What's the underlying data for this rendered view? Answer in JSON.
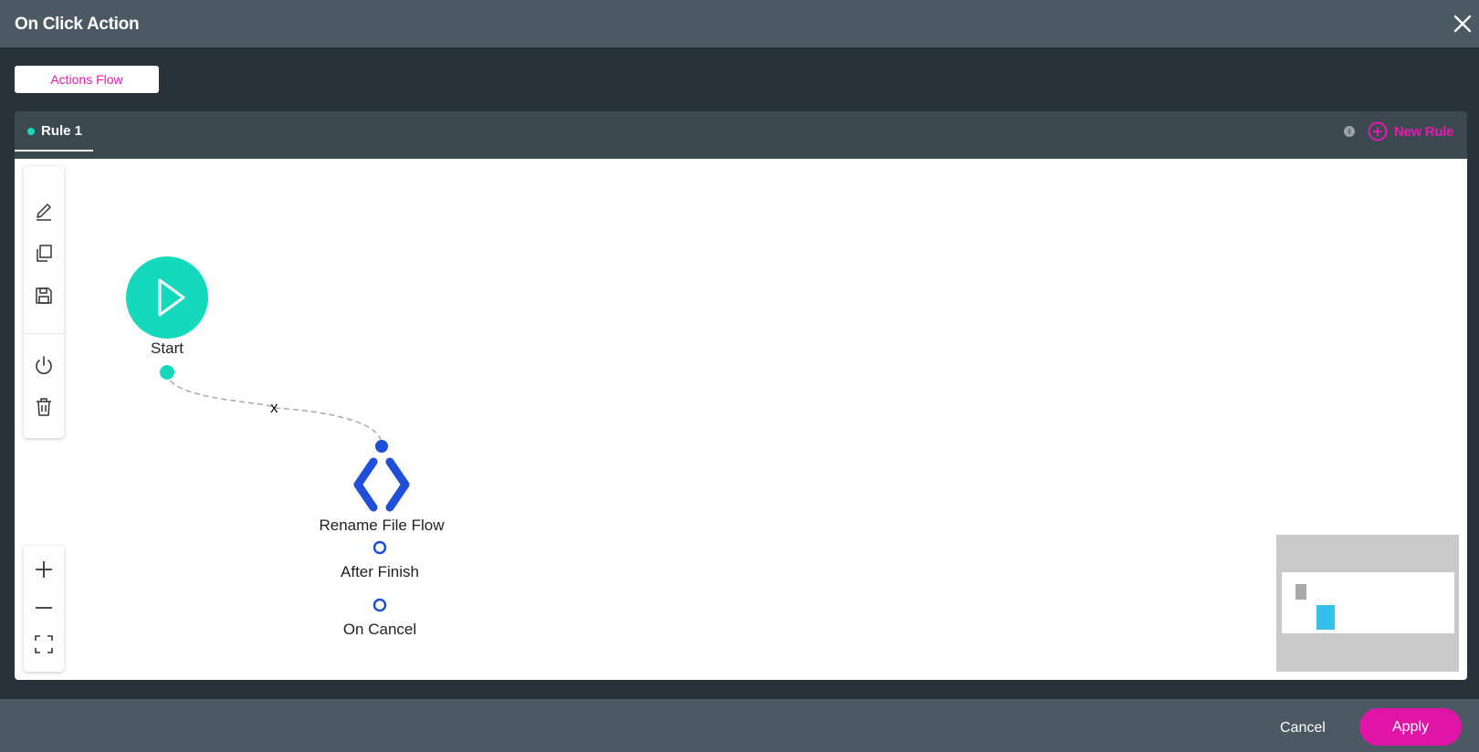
{
  "dialog": {
    "title": "On Click Action",
    "close_icon": "close-icon"
  },
  "tabs": [
    {
      "label": "Actions Flow",
      "active": true
    }
  ],
  "rules": {
    "items": [
      {
        "label": "Rule 1",
        "status_color": "#14d9bc"
      }
    ],
    "info_icon": "info-icon",
    "info_glyph": "i",
    "new_rule_label": "New Rule"
  },
  "toolbar": {
    "tools": [
      "edit-icon",
      "copy-icon",
      "save-icon",
      "power-icon",
      "trash-icon"
    ],
    "zoom": [
      "zoom-in-icon",
      "zoom-out-icon",
      "fit-screen-icon"
    ]
  },
  "flow": {
    "start": {
      "label": "Start",
      "color": "#14d9bc"
    },
    "connector_label": "x",
    "action": {
      "label": "Rename File Flow",
      "color": "#1f4fd8",
      "outputs": [
        "After Finish",
        "On Cancel"
      ]
    }
  },
  "footer": {
    "cancel_label": "Cancel",
    "apply_label": "Apply"
  },
  "colors": {
    "accent": "#e619ae",
    "start": "#14d9bc",
    "action": "#1f4fd8",
    "header": "#4a5962",
    "background": "#28323a"
  }
}
